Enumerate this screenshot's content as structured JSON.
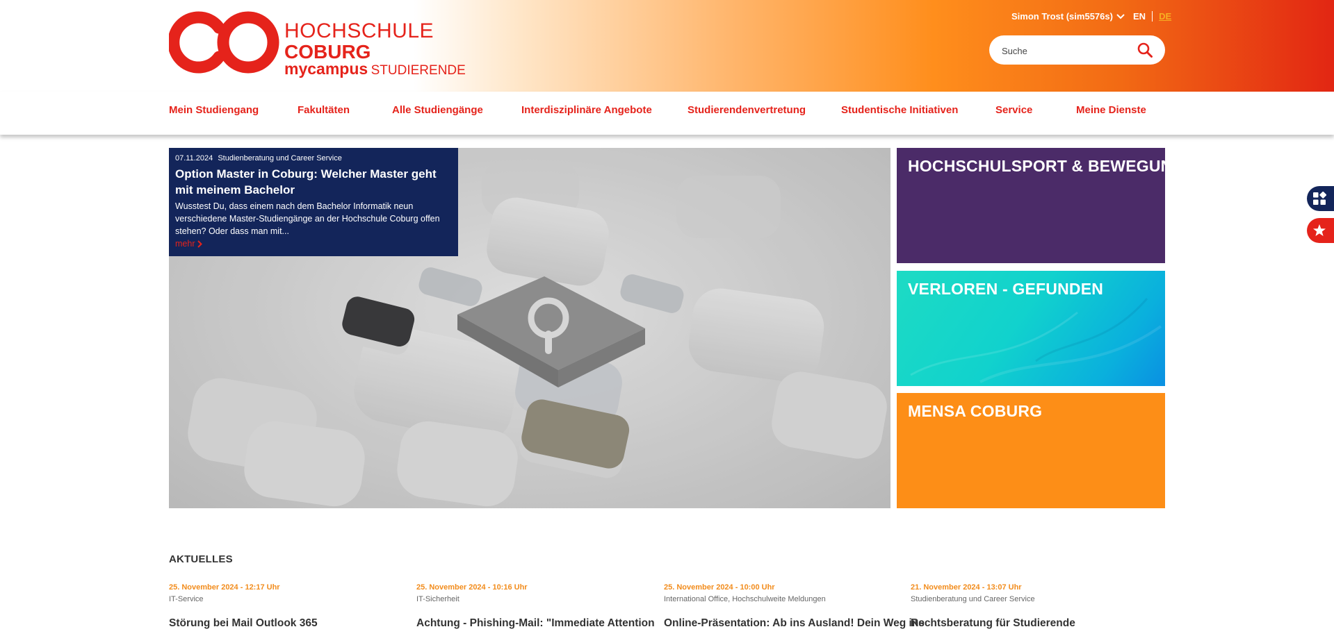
{
  "brand": {
    "line1": "HOCHSCHULE",
    "line2": "COBURG",
    "line3_bold": "mycampus",
    "line3_rest": "STUDIERENDE",
    "color": "#e5231b"
  },
  "header": {
    "user_name": "Simon Trost (sim5576s)",
    "lang_en": "EN",
    "lang_de": "DE",
    "search_placeholder": "Suche"
  },
  "nav": {
    "items": [
      {
        "label": "Mein Studiengang"
      },
      {
        "label": "Fakultäten"
      },
      {
        "label": "Alle Studiengänge"
      },
      {
        "label": "Interdisziplinäre Angebote"
      },
      {
        "label": "Studierendenvertretung"
      },
      {
        "label": "Studentische Initiativen"
      },
      {
        "label": "Service"
      },
      {
        "label": "Meine Dienste"
      }
    ]
  },
  "hero": {
    "date": "07.11.2024",
    "category": "Studienberatung und Career Service",
    "title": "Option Master in Coburg: Welcher Master geht mit meinem Bachelor",
    "text": "Wusstest Du, dass einem nach dem Bachelor Informatik neun verschiedene Master-Studiengänge an der Hochschule Coburg offen stehen? Oder dass man mit...",
    "more": "mehr"
  },
  "tiles": [
    {
      "title": "HOCHSCHULSPORT & BEWEGUNG",
      "color": "#4b2b68"
    },
    {
      "title": "VERLOREN - GEFUNDEN",
      "color": "#11d2cd"
    },
    {
      "title": "MENSA COBURG",
      "color": "#fd8e17"
    }
  ],
  "side_buttons": [
    {
      "icon": "apps-grid-icon",
      "color": "#13255a"
    },
    {
      "icon": "star-icon",
      "color": "#e5231b"
    }
  ],
  "news": {
    "title": "AKTUELLES",
    "items": [
      {
        "date": "25. November 2024 - 12:17 Uhr",
        "category": "IT-Service",
        "title": "Störung bei Mail Outlook 365"
      },
      {
        "date": "25. November 2024 - 10:16 Uhr",
        "category": "IT-Sicherheit",
        "title": "Achtung - Phishing-Mail: \"Immediate Attention"
      },
      {
        "date": "25. November 2024 - 10:00 Uhr",
        "category": "International Office, Hochschulweite Meldungen",
        "title": "Online-Präsentation: Ab ins Ausland! Dein Weg ins"
      },
      {
        "date": "21. November 2024 - 13:07 Uhr",
        "category": "Studienberatung und Career Service",
        "title": "Rechtsberatung für Studierende"
      }
    ]
  }
}
